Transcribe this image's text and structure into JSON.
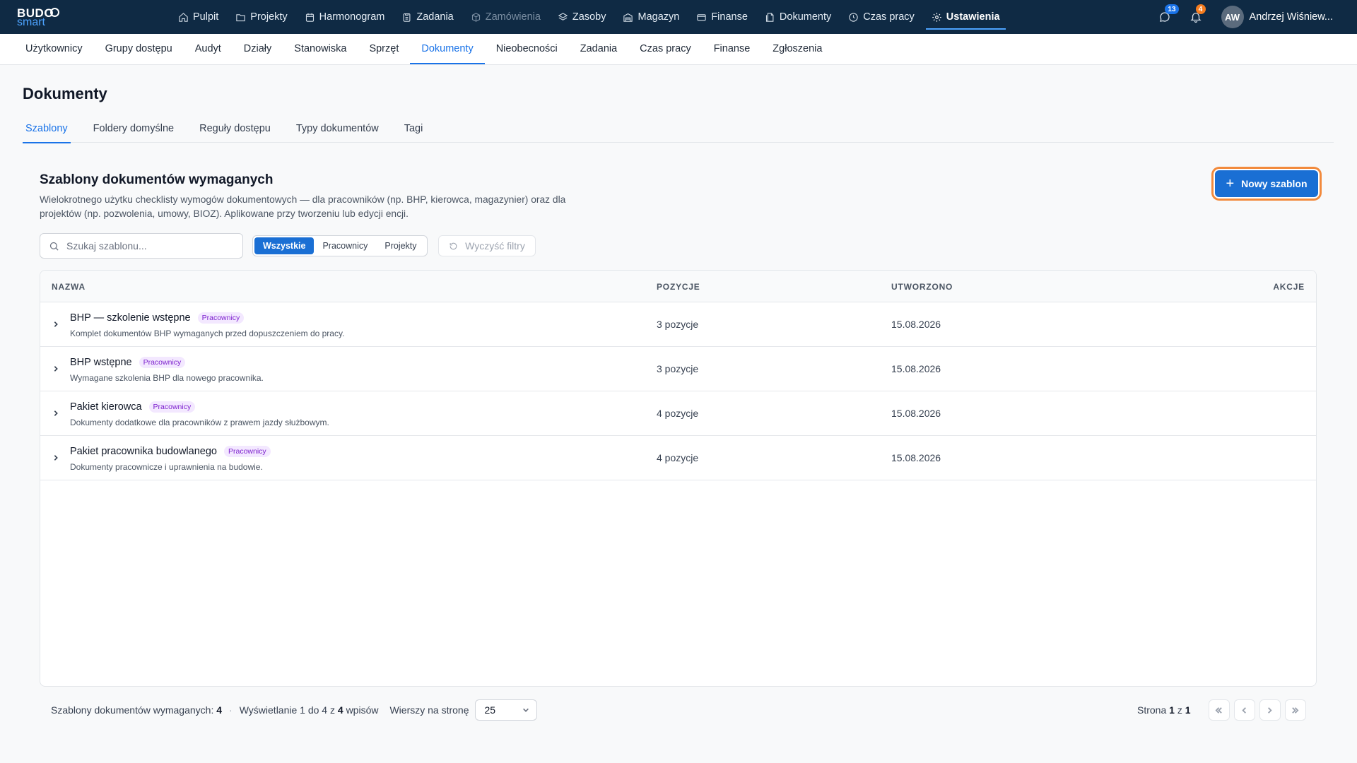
{
  "brand": {
    "line1": "BUDO",
    "line2": "smart"
  },
  "topnav": {
    "items": [
      {
        "label": "Pulpit",
        "icon": "home-icon"
      },
      {
        "label": "Projekty",
        "icon": "folder-icon"
      },
      {
        "label": "Harmonogram",
        "icon": "calendar-icon"
      },
      {
        "label": "Zadania",
        "icon": "clipboard-icon"
      },
      {
        "label": "Zamówienia",
        "icon": "box-icon",
        "disabled": true
      },
      {
        "label": "Zasoby",
        "icon": "layers-icon"
      },
      {
        "label": "Magazyn",
        "icon": "warehouse-icon"
      },
      {
        "label": "Finanse",
        "icon": "card-icon"
      },
      {
        "label": "Dokumenty",
        "icon": "documents-icon"
      },
      {
        "label": "Czas pracy",
        "icon": "clock-icon"
      },
      {
        "label": "Ustawienia",
        "icon": "gear-icon",
        "active": true
      }
    ],
    "messages_count": "13",
    "notifications_count": "4",
    "user_initials": "AW",
    "user_name": "Andrzej Wiśniew..."
  },
  "subnav": {
    "items": [
      "Użytkownicy",
      "Grupy dostępu",
      "Audyt",
      "Działy",
      "Stanowiska",
      "Sprzęt",
      "Dokumenty",
      "Nieobecności",
      "Zadania",
      "Czas pracy",
      "Finanse",
      "Zgłoszenia"
    ],
    "active_index": 6
  },
  "page": {
    "title": "Dokumenty",
    "tabs": [
      "Szablony",
      "Foldery domyślne",
      "Reguły dostępu",
      "Typy dokumentów",
      "Tagi"
    ],
    "active_tab": 0
  },
  "section": {
    "title": "Szablony dokumentów wymaganych",
    "description": "Wielokrotnego użytku checklisty wymogów dokumentowych — dla pracowników (np. BHP, kierowca, magazynier) oraz dla projektów (np. pozwolenia, umowy, BIOZ). Aplikowane przy tworzeniu lub edycji encji.",
    "new_button": "Nowy szablon"
  },
  "filters": {
    "search_placeholder": "Szukaj szablonu...",
    "segments": [
      "Wszystkie",
      "Pracownicy",
      "Projekty"
    ],
    "active_segment": 0,
    "clear_label": "Wyczyść filtry"
  },
  "table": {
    "columns": {
      "name": "NAZWA",
      "positions": "POZYCJE",
      "created": "UTWORZONO",
      "actions": "AKCJE"
    },
    "rows": [
      {
        "name": "BHP — szkolenie wstępne",
        "tag": "Pracownicy",
        "description": "Komplet dokumentów BHP wymaganych przed dopuszczeniem do pracy.",
        "positions": "3 pozycje",
        "created": "15.08.2026"
      },
      {
        "name": "BHP wstępne",
        "tag": "Pracownicy",
        "description": "Wymagane szkolenia BHP dla nowego pracownika.",
        "positions": "3 pozycje",
        "created": "15.08.2026"
      },
      {
        "name": "Pakiet kierowca",
        "tag": "Pracownicy",
        "description": "Dokumenty dodatkowe dla pracowników z prawem jazdy służbowym.",
        "positions": "4 pozycje",
        "created": "15.08.2026"
      },
      {
        "name": "Pakiet pracownika budowlanego",
        "tag": "Pracownicy",
        "description": "Dokumenty pracownicze i uprawnienia na budowie.",
        "positions": "4 pozycje",
        "created": "15.08.2026"
      }
    ]
  },
  "footer": {
    "total_label": "Szablony dokumentów wymaganych:",
    "total": "4",
    "showing_prefix": "Wyświetlanie 1 do 4 z",
    "showing_total": "4",
    "showing_suffix": "wpisów",
    "rows_label": "Wierszy na stronę",
    "rows_value": "25",
    "page_prefix": "Strona",
    "page_current": "1",
    "page_sep": "z",
    "page_total": "1"
  },
  "colors": {
    "nav_bg": "#0f2a44",
    "accent": "#1a6fd4",
    "focus_ring": "#f28a3c",
    "tag_bg": "#f3e8ff",
    "tag_text": "#7e22ce"
  }
}
